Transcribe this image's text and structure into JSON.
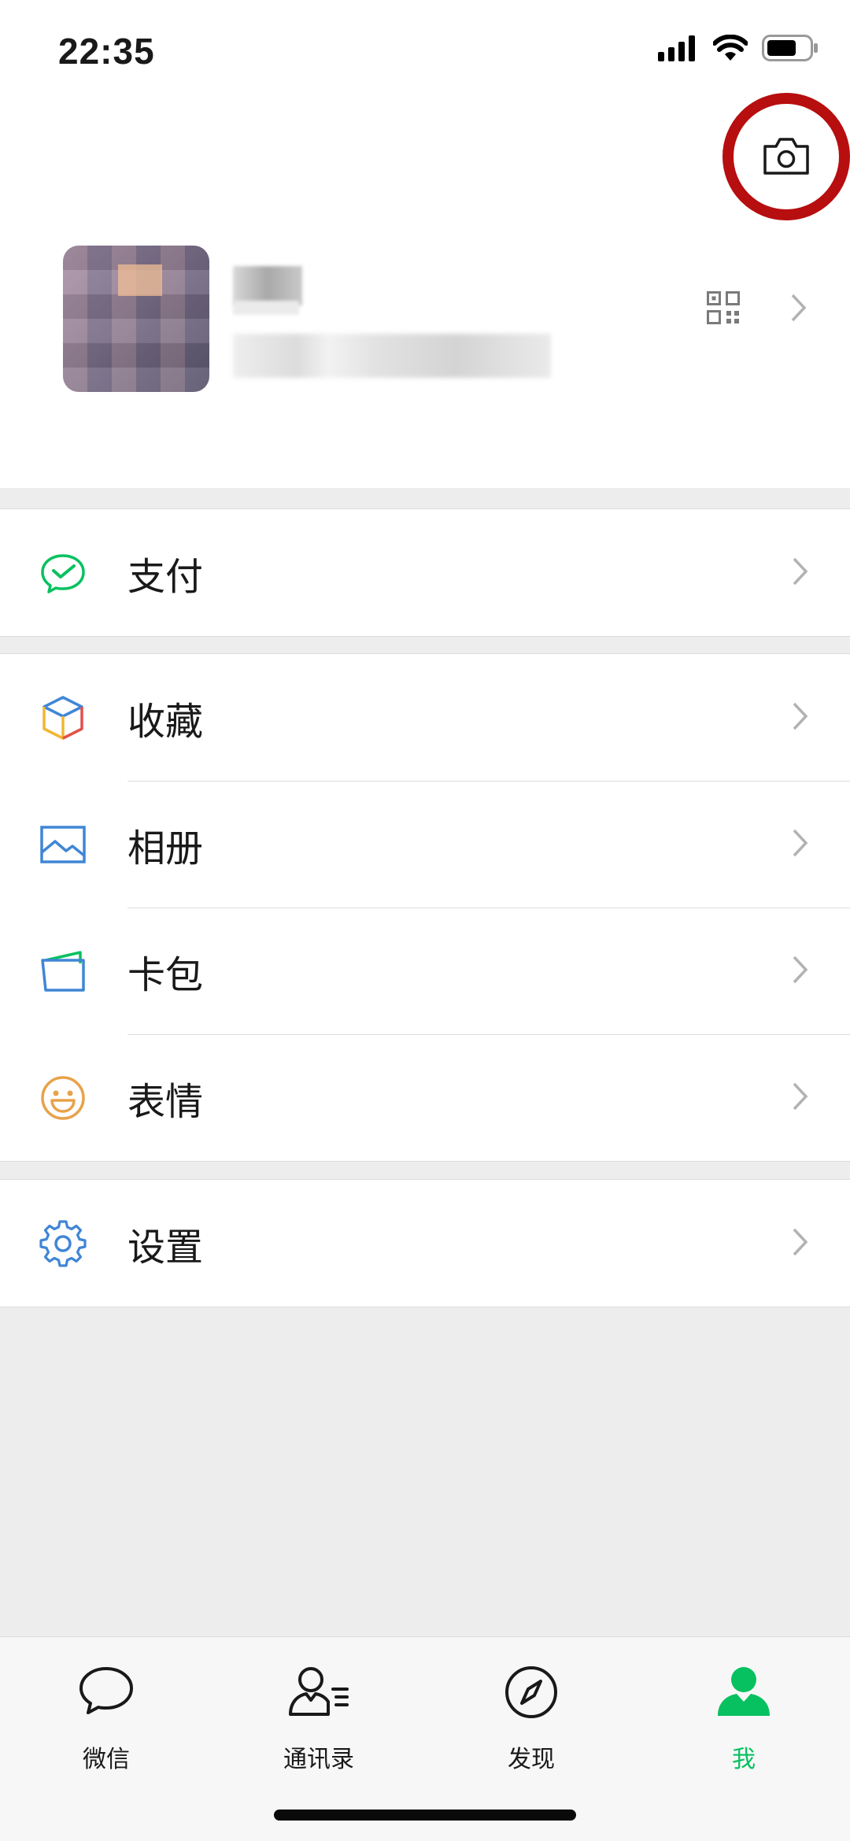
{
  "status_bar": {
    "time": "22:35",
    "icons": [
      "signal-icon",
      "wifi-icon",
      "battery-icon"
    ]
  },
  "profile": {
    "camera_icon": "camera-icon",
    "qr_icon": "qr-code-icon",
    "chevron_icon": "chevron-right-icon"
  },
  "menu": {
    "group1": [
      {
        "label": "支付",
        "icon": "payment-icon",
        "color": "#07c160"
      }
    ],
    "group2": [
      {
        "label": "收藏",
        "icon": "favorites-cube-icon",
        "color": "#5b8dd6"
      },
      {
        "label": "相册",
        "icon": "album-icon",
        "color": "#3f86d6"
      },
      {
        "label": "卡包",
        "icon": "card-wallet-icon",
        "color": "#3f86d6"
      },
      {
        "label": "表情",
        "icon": "sticker-smiley-icon",
        "color": "#e8a24a"
      }
    ],
    "group3": [
      {
        "label": "设置",
        "icon": "settings-gear-icon",
        "color": "#3f86d6"
      }
    ]
  },
  "tabbar": {
    "tabs": [
      {
        "label": "微信",
        "icon": "chat-bubble-icon",
        "active": false
      },
      {
        "label": "通讯录",
        "icon": "contacts-icon",
        "active": false
      },
      {
        "label": "发现",
        "icon": "discover-compass-icon",
        "active": false
      },
      {
        "label": "我",
        "icon": "me-person-icon",
        "active": true
      }
    ],
    "active_color": "#07c160"
  },
  "colors": {
    "annotation_ring": "#b70e0f",
    "background": "#ededed"
  }
}
